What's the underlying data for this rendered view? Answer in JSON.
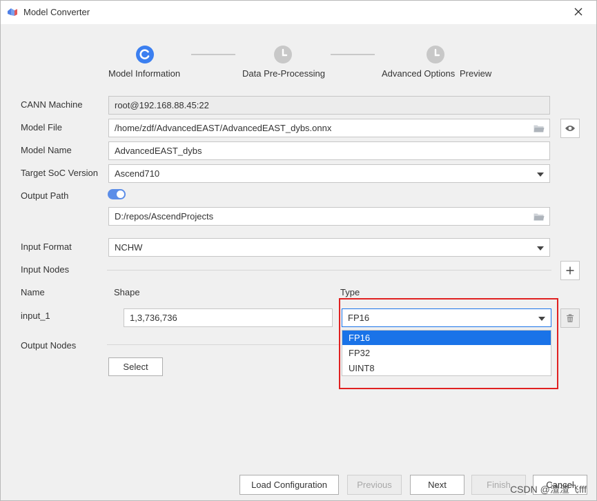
{
  "window": {
    "title": "Model Converter"
  },
  "colors": {
    "accent": "#1a73e8",
    "step_active": "#3b7ff0",
    "step_inactive": "#c8c8c8",
    "highlight": "#e02020",
    "toggle": "#5b8de8"
  },
  "steps": [
    {
      "label": "Model Information",
      "icon": "active-step-icon"
    },
    {
      "label": "Data Pre-Processing",
      "icon": "clock-icon"
    },
    {
      "label": "Advanced Options",
      "icon": "clock-icon"
    },
    {
      "label": "Preview"
    }
  ],
  "form": {
    "cann_machine": {
      "label": "CANN Machine",
      "value": "root@192.168.88.45:22"
    },
    "model_file": {
      "label": "Model File",
      "value": "/home/zdf/AdvancedEAST/AdvancedEAST_dybs.onnx"
    },
    "model_name": {
      "label": "Model Name",
      "value": "AdvancedEAST_dybs"
    },
    "target_soc": {
      "label": "Target SoC Version",
      "value": "Ascend710"
    },
    "output_path": {
      "label": "Output Path",
      "value": "D:/repos/AscendProjects",
      "toggle_on": true
    },
    "input_format": {
      "label": "Input Format",
      "value": "NCHW"
    },
    "input_nodes": {
      "label": "Input Nodes",
      "headers": {
        "name": "Name",
        "shape": "Shape",
        "type": "Type"
      },
      "rows": [
        {
          "name": "input_1",
          "shape": "1,3,736,736",
          "type": "FP16"
        }
      ],
      "type_options": [
        "FP16",
        "FP32",
        "UINT8"
      ],
      "type_selected": "FP16"
    },
    "output_nodes": {
      "label": "Output Nodes",
      "select_label": "Select"
    }
  },
  "footer": {
    "load_config": "Load Configuration",
    "previous": "Previous",
    "next": "Next",
    "finish": "Finish",
    "cancel": "Cancel"
  },
  "watermark": "CSDN @渣渣飞fff"
}
